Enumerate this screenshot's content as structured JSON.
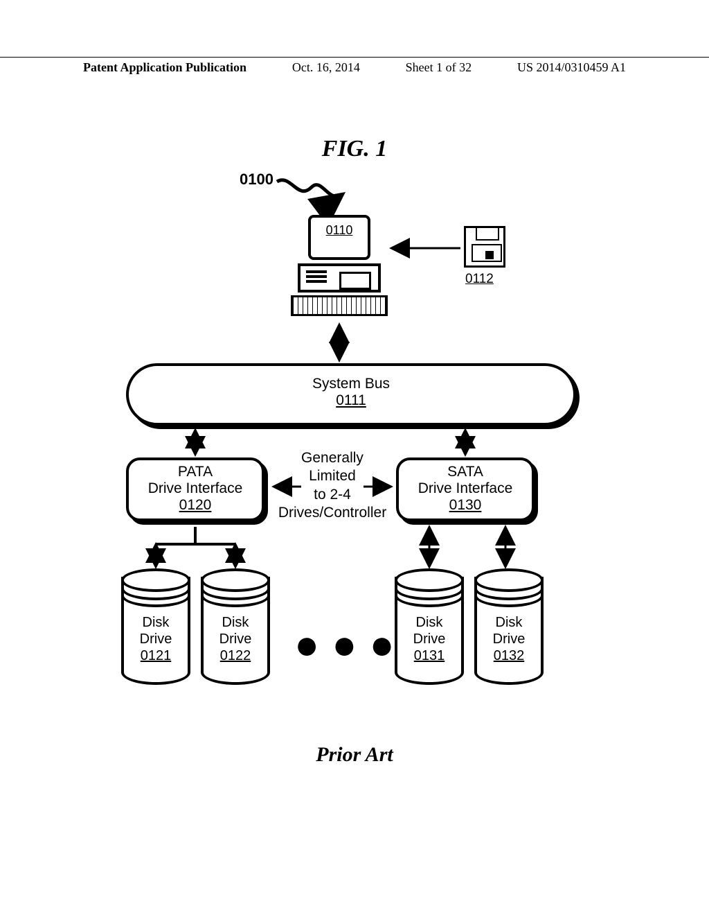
{
  "header": {
    "left": "Patent Application Publication",
    "date": "Oct. 16, 2014",
    "sheet": "Sheet 1 of 32",
    "pubno": "US 2014/0310459 A1"
  },
  "figure": {
    "title": "FIG. 1",
    "ref": "0100",
    "prior_art": "Prior Art"
  },
  "computer": {
    "num": "0110"
  },
  "floppy": {
    "num": "0112"
  },
  "systembus": {
    "label": "System Bus",
    "num": "0111"
  },
  "pata": {
    "line1": "PATA",
    "line2": "Drive Interface",
    "num": "0120"
  },
  "sata": {
    "line1": "SATA",
    "line2": "Drive Interface",
    "num": "0130"
  },
  "center": {
    "l1": "Generally",
    "l2": "Limited",
    "l3": "to 2-4",
    "l4": "Drives/Controller"
  },
  "disks": [
    {
      "l1": "Disk",
      "l2": "Drive",
      "num": "0121"
    },
    {
      "l1": "Disk",
      "l2": "Drive",
      "num": "0122"
    },
    {
      "l1": "Disk",
      "l2": "Drive",
      "num": "0131"
    },
    {
      "l1": "Disk",
      "l2": "Drive",
      "num": "0132"
    }
  ]
}
